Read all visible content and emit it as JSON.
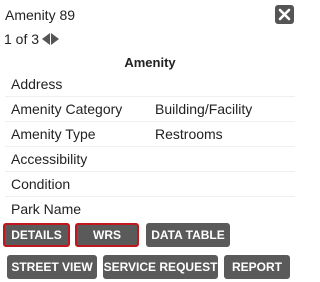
{
  "header": {
    "title": "Amenity 89"
  },
  "pager": {
    "text": "1 of 3"
  },
  "section": {
    "title": "Amenity"
  },
  "attributes": [
    {
      "key": "Address",
      "value": ""
    },
    {
      "key": "Amenity Category",
      "value": "Building/Facility"
    },
    {
      "key": "Amenity Type",
      "value": "Restrooms"
    },
    {
      "key": "Accessibility",
      "value": ""
    },
    {
      "key": "Condition",
      "value": ""
    },
    {
      "key": "Park Name",
      "value": ""
    }
  ],
  "buttons": {
    "details": "DETAILS",
    "wrs": "WRS",
    "data_table": "DATA TABLE",
    "street_view": "STREET VIEW",
    "service_request": "SERVICE REQUEST",
    "report": "REPORT"
  },
  "colors": {
    "button_bg": "#5a5a5a",
    "active_border": "#c0161d",
    "icon_bg": "#555555"
  },
  "icons": {
    "close": "close-icon",
    "prev": "triangle-left-icon",
    "next": "triangle-right-icon"
  }
}
